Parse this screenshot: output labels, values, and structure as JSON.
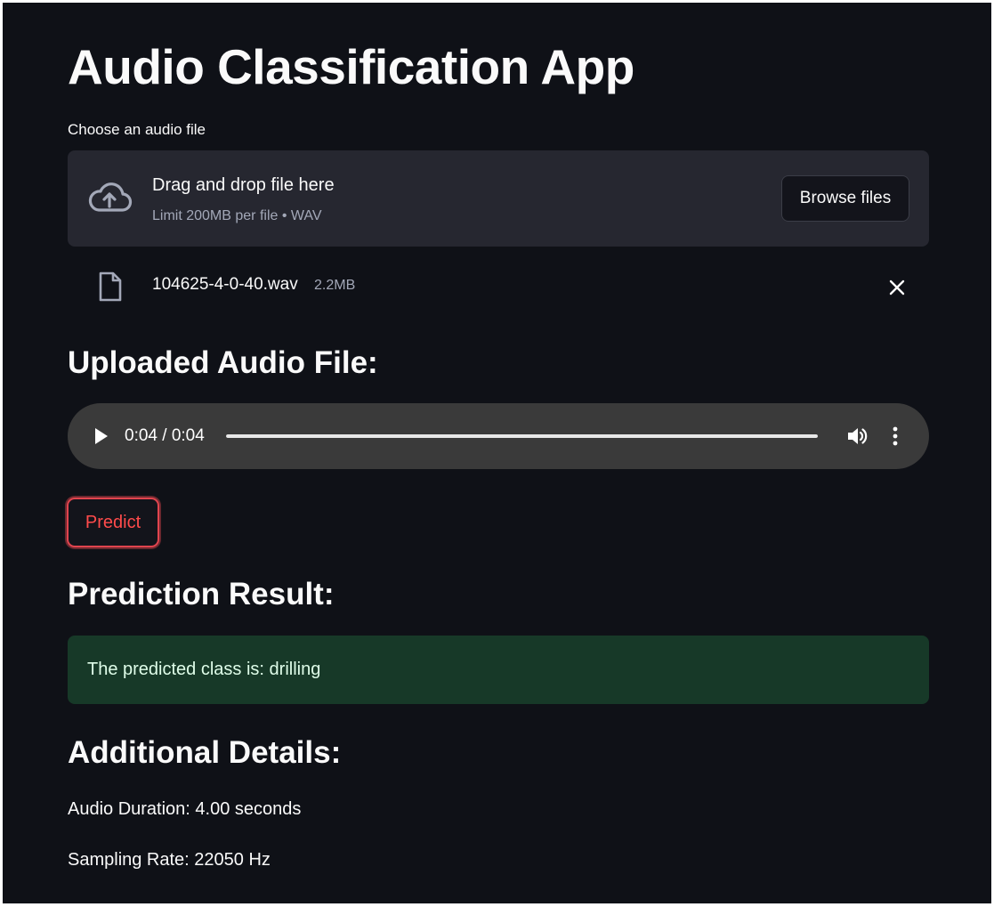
{
  "app": {
    "title": "Audio Classification App"
  },
  "uploader": {
    "label": "Choose an audio file",
    "drop_text": "Drag and drop file here",
    "limit_text": "Limit 200MB per file • WAV",
    "browse_label": "Browse files",
    "icon": "cloud-upload-icon"
  },
  "uploaded_file": {
    "name": "104625-4-0-40.wav",
    "size": "2.2MB",
    "icon": "file-icon",
    "remove_icon": "close-icon"
  },
  "uploaded_section": {
    "heading": "Uploaded Audio File:"
  },
  "audio_player": {
    "time": "0:04 / 0:04",
    "progress_fraction": 1.0,
    "icons": [
      "play-icon",
      "volume-icon",
      "more-options-icon"
    ]
  },
  "predict_button": {
    "label": "Predict",
    "accent_color": "#ff4b4b"
  },
  "prediction": {
    "heading": "Prediction Result:",
    "message": "The predicted class is: drilling",
    "status_color": "#173928"
  },
  "details": {
    "heading": "Additional Details:",
    "duration": "Audio Duration: 4.00 seconds",
    "sampling_rate": "Sampling Rate: 22050 Hz"
  }
}
